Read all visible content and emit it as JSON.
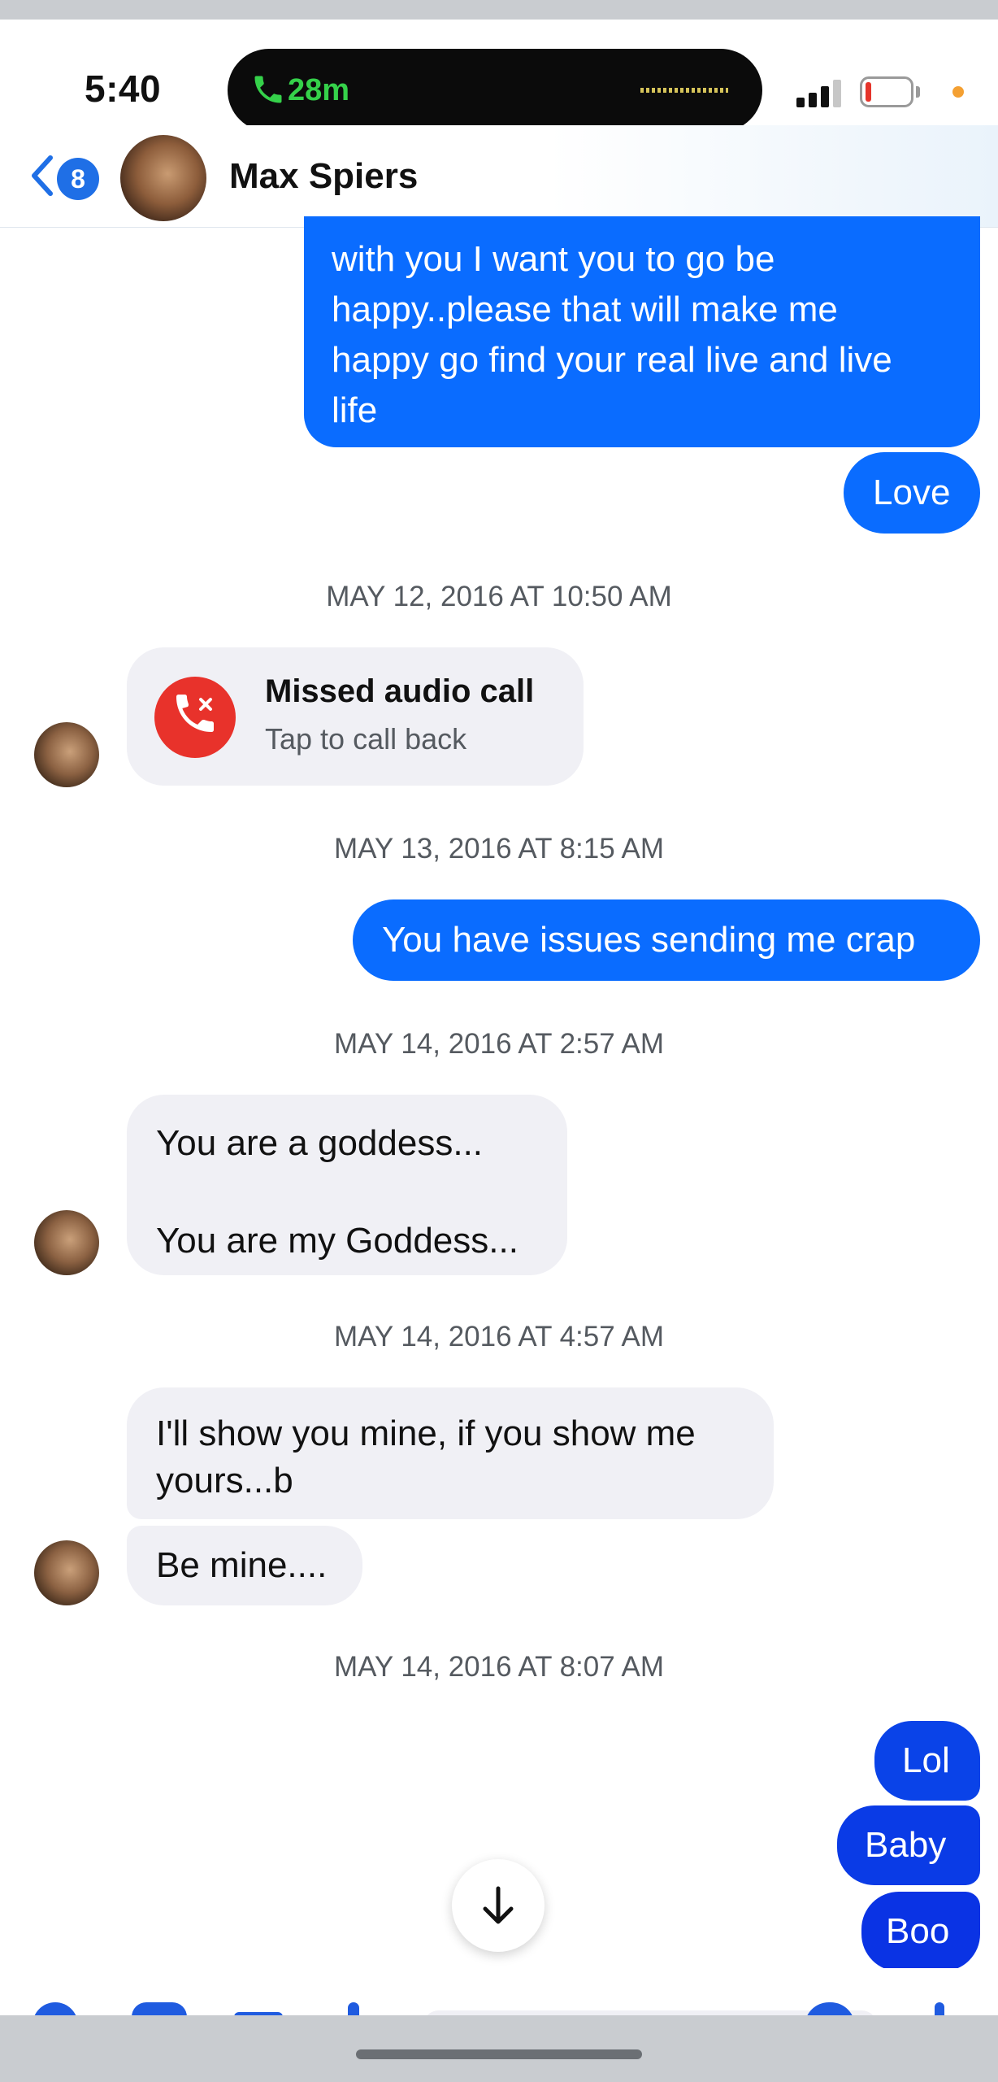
{
  "status_bar": {
    "time": "5:40",
    "call_duration": "28m"
  },
  "header": {
    "unread_count": "8",
    "contact_name": "Max Spiers"
  },
  "messages": {
    "top_out_lines": [
      "with you I want you to go be",
      "happy..please that will make me",
      "happy go find your real live and live",
      "life"
    ],
    "love": "Love",
    "ts1": "MAY 12, 2016 AT 10:50 AM",
    "missed_call_title": "Missed audio call",
    "missed_call_sub": "Tap to call back",
    "ts2": "MAY 13, 2016 AT 8:15 AM",
    "issues": "You have issues sending me crap",
    "ts3": "MAY 14, 2016 AT 2:57 AM",
    "goddess_1": "You are a goddess...",
    "goddess_2": "You are my Goddess...",
    "ts4": "MAY 14, 2016 AT 4:57 AM",
    "show_line1": "I'll show you mine, if you show me",
    "show_line2": "yours...b",
    "be_mine": "Be mine....",
    "ts5": "MAY 14, 2016 AT 8:07 AM",
    "lol": "Lol",
    "baby": "Baby",
    "boo": "Boo"
  },
  "colors": {
    "outgoing": "#0a6cff",
    "incoming": "#f0f0f5",
    "missed_call": "#e8322b",
    "call_timer": "#35d14a"
  },
  "icons": [
    "phone-icon",
    "back-chevron-icon",
    "missed-call-icon",
    "arrow-down-icon",
    "signal-icon",
    "battery-icon"
  ]
}
